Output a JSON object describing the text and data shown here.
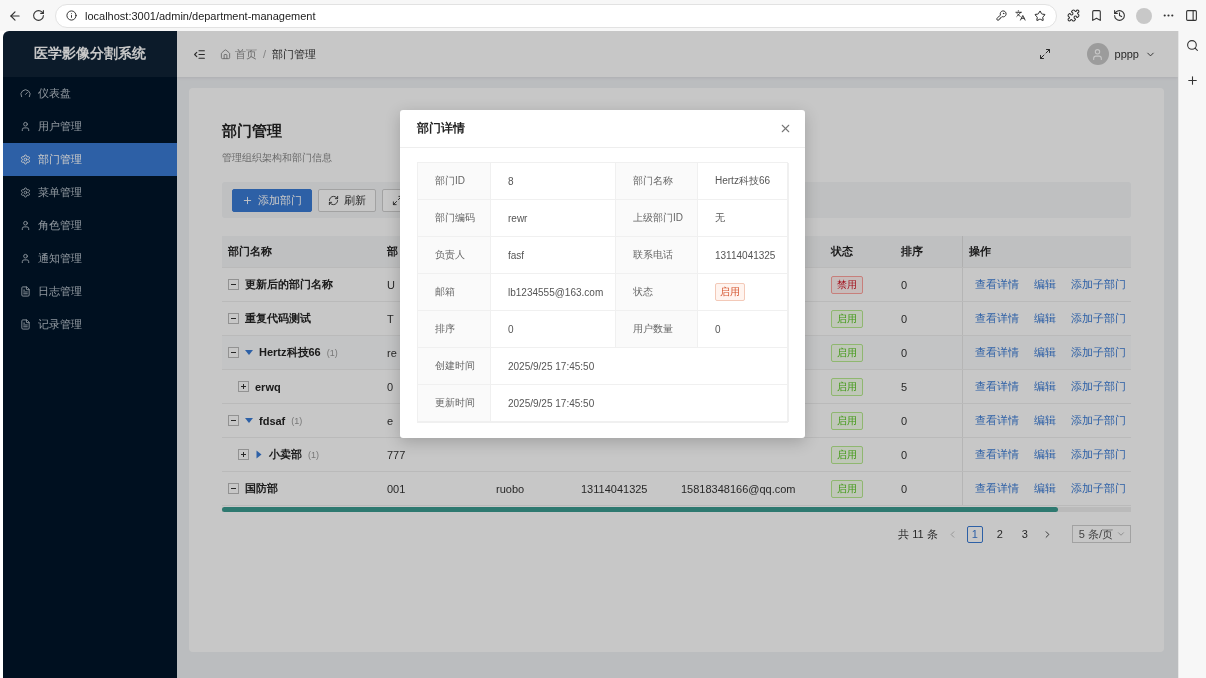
{
  "browser": {
    "url": "localhost:3001/admin/department-management"
  },
  "sidebar": {
    "title": "医学影像分割系统",
    "items": [
      {
        "label": "仪表盘",
        "kind": "dashboard",
        "selected": false
      },
      {
        "label": "用户管理",
        "kind": "user",
        "selected": false
      },
      {
        "label": "部门管理",
        "kind": "gear",
        "selected": true
      },
      {
        "label": "菜单管理",
        "kind": "gear",
        "selected": false
      },
      {
        "label": "角色管理",
        "kind": "user",
        "selected": false
      },
      {
        "label": "通知管理",
        "kind": "user",
        "selected": false
      },
      {
        "label": "日志管理",
        "kind": "doc",
        "selected": false
      },
      {
        "label": "记录管理",
        "kind": "doc",
        "selected": false
      }
    ]
  },
  "header": {
    "breadcrumb": [
      "首页",
      "部门管理"
    ],
    "separator": "/",
    "user": "pppp"
  },
  "page": {
    "title": "部门管理",
    "subtitle": "管理组织架构和部门信息"
  },
  "toolbar": [
    {
      "label": "添加部门",
      "kind": "primary"
    },
    {
      "label": "刷新",
      "kind": "refresh"
    },
    {
      "kind": "expand"
    }
  ],
  "table": {
    "columns": [
      "部门名称",
      "部",
      "状态",
      "排序",
      "操作"
    ],
    "rows": [
      {
        "name": "更新后的部门名称",
        "code": "U",
        "open": true,
        "highlighted": false,
        "enabled": false,
        "status": "禁用",
        "sort": "0",
        "actions": [
          "查看详情",
          "编辑",
          "添加子部门"
        ]
      },
      {
        "name": "重复代码测试",
        "code": "T",
        "open": true,
        "highlighted": false,
        "enabled": true,
        "status": "启用",
        "sort": "0",
        "actions": [
          "查看详情",
          "编辑",
          "添加子部门"
        ]
      },
      {
        "name": "Hertz科技66",
        "count": "(1)",
        "expanded": true,
        "code": "re",
        "open": true,
        "highlighted": true,
        "enabled": true,
        "status": "启用",
        "sort": "0",
        "actions": [
          "查看详情",
          "编辑",
          "添加子部门"
        ],
        "children": [
          {
            "name": "erwq",
            "code": "0",
            "open": false,
            "highlighted": false,
            "enabled": true,
            "status": "启用",
            "sort": "5",
            "actions": [
              "查看详情",
              "编辑",
              "添加子部门"
            ]
          }
        ]
      },
      {
        "name": "fdsaf",
        "count": "(1)",
        "expanded": true,
        "code": "e",
        "open": true,
        "highlighted": false,
        "enabled": true,
        "status": "启用",
        "sort": "0",
        "actions": [
          "查看详情",
          "编辑",
          "添加子部门"
        ],
        "children": [
          {
            "name": "小卖部",
            "count": "(1)",
            "expanded": false,
            "code": "777",
            "open": false,
            "highlighted": false,
            "enabled": true,
            "status": "启用",
            "sort": "0",
            "actions": [
              "查看详情",
              "编辑",
              "添加子部门"
            ]
          }
        ]
      },
      {
        "name": "国防部",
        "code": "001",
        "owner": "ruobo",
        "phone": "13114041325",
        "email": "15818348166@qq.com",
        "open": true,
        "highlighted": false,
        "enabled": true,
        "status": "启用",
        "sort": "0",
        "actions": [
          "查看详情",
          "编辑",
          "添加子部门"
        ]
      }
    ]
  },
  "pagination": {
    "total": "共 11 条",
    "pages": [
      {
        "label": "1",
        "selected": true
      },
      {
        "label": "2",
        "selected": false
      },
      {
        "label": "3",
        "selected": false
      }
    ],
    "page_size": "5 条/页"
  },
  "modal": {
    "title": "部门详情",
    "fields": [
      {
        "label": "部门ID",
        "value": "8",
        "kind": "text",
        "wide": false
      },
      {
        "label": "部门名称",
        "value": "Hertz科技66",
        "kind": "text",
        "wide": false
      },
      {
        "label": "部门编码",
        "value": "rewr",
        "kind": "text",
        "wide": false
      },
      {
        "label": "上级部门ID",
        "value": "无",
        "kind": "text",
        "wide": false
      },
      {
        "label": "负责人",
        "value": "fasf",
        "kind": "text",
        "wide": false
      },
      {
        "label": "联系电话",
        "value": "13114041325",
        "kind": "text",
        "wide": false
      },
      {
        "label": "邮箱",
        "value": "lb1234555@163.com",
        "kind": "text",
        "wide": false
      },
      {
        "label": "状态",
        "value": "启用",
        "kind": "tag",
        "wide": false
      },
      {
        "label": "排序",
        "value": "0",
        "kind": "text",
        "wide": false
      },
      {
        "label": "用户数量",
        "value": "0",
        "kind": "text",
        "wide": false
      },
      {
        "label": "创建时间",
        "value": "2025/9/25 17:45:50",
        "kind": "text",
        "wide": true
      },
      {
        "label": "更新时间",
        "value": "2025/9/25 17:45:50",
        "kind": "text",
        "wide": true
      }
    ]
  }
}
